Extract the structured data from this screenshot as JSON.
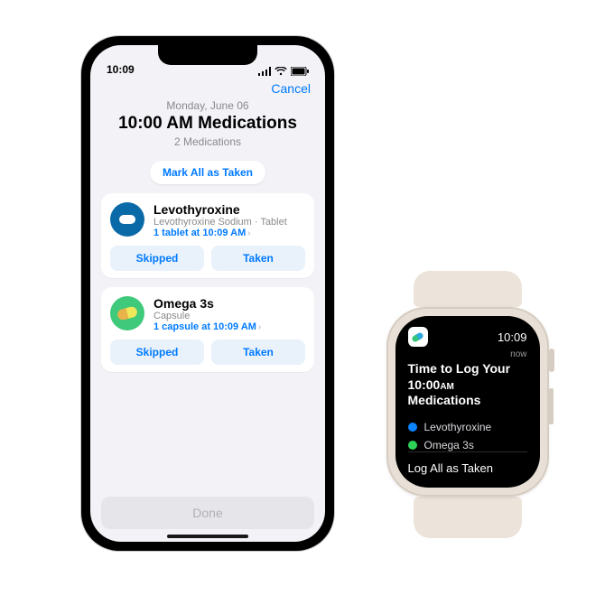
{
  "phone": {
    "status": {
      "time": "10:09"
    },
    "topbar": {
      "cancel_label": "Cancel"
    },
    "header": {
      "date": "Monday, June 06",
      "title": "10:00 AM Medications",
      "subtitle": "2 Medications"
    },
    "mark_all_label": "Mark All as Taken",
    "medications": [
      {
        "name": "Levothyroxine",
        "description": "Levothyroxine Sodium · Tablet",
        "dose": "1 tablet at 10:09 AM",
        "icon_color": "blue",
        "icon_name": "tablet-icon"
      },
      {
        "name": "Omega 3s",
        "description": "Capsule",
        "dose": "1 capsule at 10:09 AM",
        "icon_color": "green",
        "icon_name": "capsule-icon"
      }
    ],
    "buttons": {
      "skipped": "Skipped",
      "taken": "Taken"
    },
    "done_label": "Done"
  },
  "watch": {
    "time": "10:09",
    "now_label": "now",
    "title_line1": "Time to Log Your",
    "title_line2_time": "10:00",
    "title_line2_ampm": "AM",
    "title_line2_rest": " Medications",
    "items": [
      {
        "label": "Levothyroxine",
        "color": "blue"
      },
      {
        "label": "Omega 3s",
        "color": "green"
      }
    ],
    "log_label": "Log All as Taken"
  }
}
